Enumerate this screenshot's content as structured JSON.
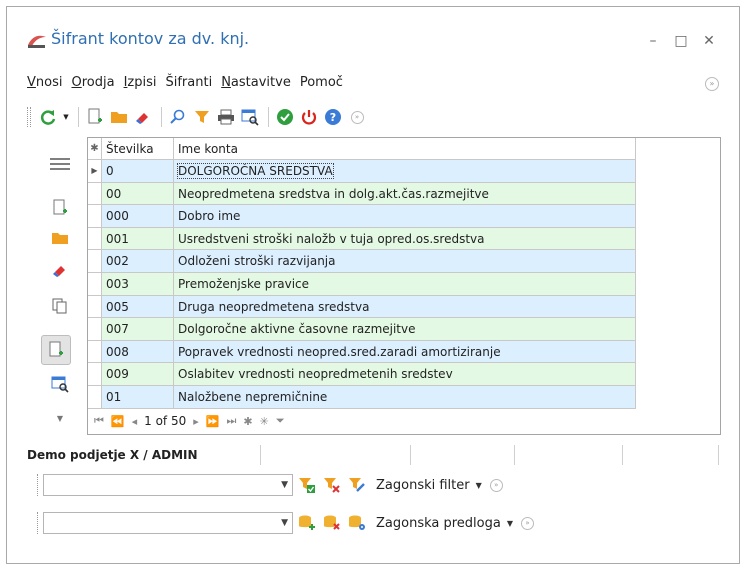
{
  "window": {
    "title": "Šifrant kontov za dv. knj.",
    "controls": {
      "minimize": "–",
      "maximize": "□",
      "close": "✕"
    }
  },
  "menu": {
    "items": [
      {
        "first": "V",
        "rest": "nosi"
      },
      {
        "first": "O",
        "rest": "rodja"
      },
      {
        "first": "I",
        "rest": "zpisi"
      },
      {
        "first": "",
        "rest": "Šifranti"
      },
      {
        "first": "N",
        "rest": "astavitve"
      },
      {
        "first": "",
        "rest": "Pomoč"
      }
    ]
  },
  "toolbar": {
    "icons": [
      "refresh-icon",
      "new-document-icon",
      "open-folder-icon",
      "eraser-icon",
      "search-icon",
      "filter-icon",
      "print-icon",
      "table-search-icon",
      "ok-icon",
      "power-icon",
      "help-icon",
      "collapse-icon"
    ]
  },
  "grid": {
    "columns": {
      "indicator": "✱",
      "number": "Številka",
      "name": "Ime konta"
    },
    "rows": [
      {
        "number": "0",
        "name": "DOLGOROČNA SREDSTVA",
        "color": "blue",
        "current": true
      },
      {
        "number": "00",
        "name": "Neopredmetena sredstva in dolg.akt.čas.razmejitve",
        "color": "green"
      },
      {
        "number": "000",
        "name": "Dobro ime",
        "color": "blue"
      },
      {
        "number": "001",
        "name": "Usredstveni stroški naložb v tuja opred.os.sredstva",
        "color": "green"
      },
      {
        "number": "002",
        "name": "Odloženi stroški razvijanja",
        "color": "blue"
      },
      {
        "number": "003",
        "name": "Premoženjske pravice",
        "color": "green"
      },
      {
        "number": "005",
        "name": "Druga neopredmetena sredstva",
        "color": "blue"
      },
      {
        "number": "007",
        "name": "Dolgoročne aktivne časovne razmejitve",
        "color": "green"
      },
      {
        "number": "008",
        "name": "Popravek vrednosti neopred.sred.zaradi amortiziranje",
        "color": "blue"
      },
      {
        "number": "009",
        "name": "Oslabitev vrednosti neopredmetenih sredstev",
        "color": "green"
      },
      {
        "number": "01",
        "name": "Naložbene nepremičnine",
        "color": "blue"
      }
    ],
    "navigator": {
      "position": "1 of 50"
    }
  },
  "status": {
    "user": "Demo podjetje X / ADMIN"
  },
  "filters": {
    "filter_label": "Zagonski filter",
    "template_label": "Zagonska predloga",
    "filter_value": "",
    "template_value": ""
  },
  "colors": {
    "title": "#2f6fb3",
    "row_blue": "#dcefff",
    "row_green": "#e4f9e4"
  }
}
